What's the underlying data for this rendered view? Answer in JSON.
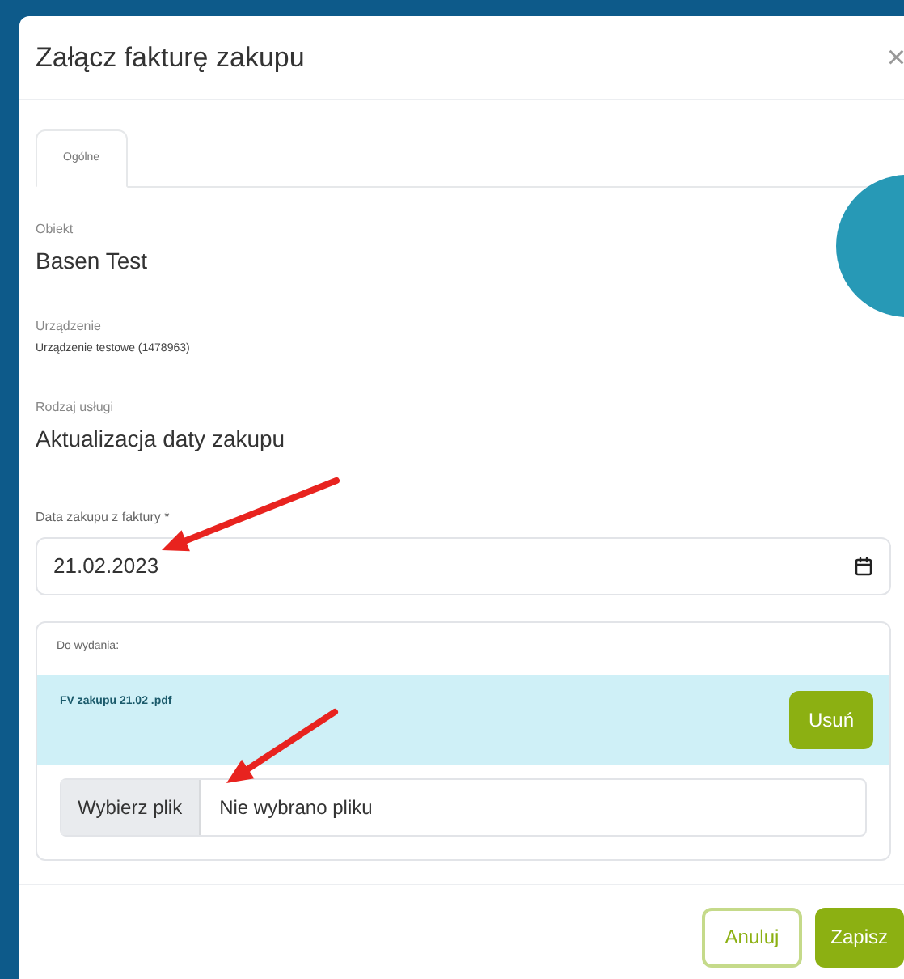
{
  "dialog": {
    "title": "Załącz fakturę zakupu",
    "close": "×"
  },
  "tabs": [
    {
      "label": "Ogólne",
      "selected": true
    }
  ],
  "fields": [
    {
      "label": "Obiekt",
      "value": "Basen Test",
      "kind": "large"
    },
    {
      "label": "Urządzenie",
      "value": "Urządzenie testowe (1478963)",
      "kind": "small"
    },
    {
      "label": "Rodzaj usługi",
      "value": "Aktualizacja daty zakupu",
      "kind": "large"
    }
  ],
  "date_field": {
    "label": "Data zakupu z faktury *",
    "value": "21.02.2023"
  },
  "attachments": {
    "title": "Do wydania:",
    "files": [
      {
        "name": "FV zakupu 21.02 .pdf",
        "remove": "Usuń"
      }
    ],
    "file_input": {
      "button": "Wybierz plik",
      "status": "Nie wybrano pliku"
    }
  },
  "buttons": [
    {
      "label": "Anuluj",
      "kind": "outline"
    },
    {
      "label": "Zapisz",
      "kind": "primary"
    }
  ]
}
